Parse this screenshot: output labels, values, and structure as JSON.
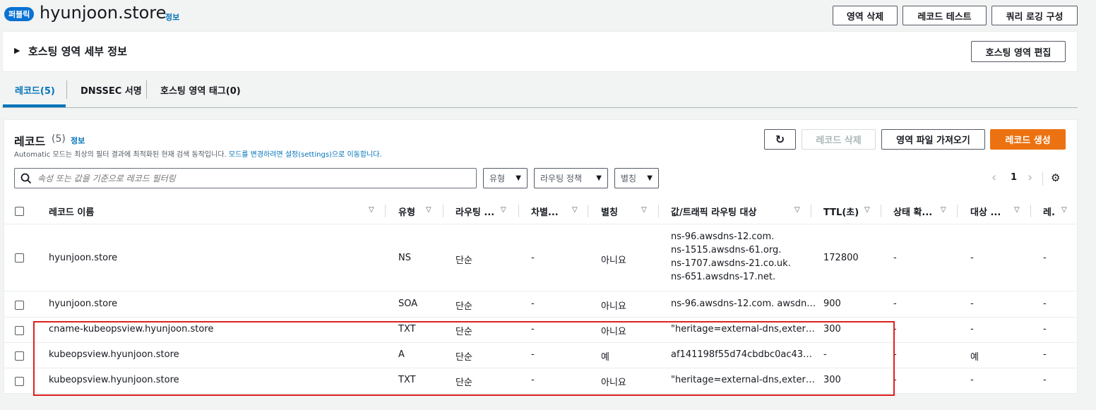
{
  "header": {
    "badge": "퍼블릭",
    "title": "hyunjoon.store",
    "info": "정보",
    "buttons": [
      "영역 삭제",
      "레코드 테스트",
      "쿼리 로깅 구성"
    ]
  },
  "details": {
    "label": "호스팅 영역 세부 정보",
    "edit_button": "호스팅 영역 편집"
  },
  "tabs": [
    "레코드(5)",
    "DNSSEC 서명",
    "호스팅 영역 태그(0)"
  ],
  "records": {
    "title": "레코드",
    "count": "(5)",
    "info": "정보",
    "desc_prefix": "Automatic 모드는 최상의 필터 결과에 최적화된 현재 검색 동작입니다.",
    "desc_link": "모드를 변경하려면 설정(settings)으로 이동합니다.",
    "buttons": {
      "delete": "레코드 삭제",
      "import": "영역 파일 가져오기",
      "create": "레코드 생성"
    },
    "search_placeholder": "속성 또는 값을 기준으로 레코드 필터링",
    "filters": [
      "유형",
      "라우팅 정책",
      "별칭"
    ],
    "page": "1",
    "columns": [
      "레코드 이름",
      "유형",
      "라우팅 ...",
      "차별...",
      "별칭",
      "값/트래픽 라우팅 대상",
      "TTL(초)",
      "상태 확...",
      "대상 ...",
      "레."
    ],
    "rows": [
      {
        "name": "hyunjoon.store",
        "type": "NS",
        "routing": "단순",
        "diff": "-",
        "alias": "아니요",
        "value": [
          "ns-96.awsdns-12.com.",
          "ns-1515.awsdns-61.org.",
          "ns-1707.awsdns-21.co.uk.",
          "ns-651.awsdns-17.net."
        ],
        "ttl": "172800",
        "health": "-",
        "target": "-",
        "rec": "-"
      },
      {
        "name": "hyunjoon.store",
        "type": "SOA",
        "routing": "단순",
        "diff": "-",
        "alias": "아니요",
        "value": [
          "ns-96.awsdns-12.com. awsdn…"
        ],
        "ttl": "900",
        "health": "-",
        "target": "-",
        "rec": "-"
      },
      {
        "name": "cname-kubeopsview.hyunjoon.store",
        "type": "TXT",
        "routing": "단순",
        "diff": "-",
        "alias": "아니요",
        "value": [
          "\"heritage=external-dns,exter…"
        ],
        "ttl": "300",
        "health": "-",
        "target": "-",
        "rec": "-"
      },
      {
        "name": "kubeopsview.hyunjoon.store",
        "type": "A",
        "routing": "단순",
        "diff": "-",
        "alias": "예",
        "value": [
          "af141198f55d74cbdbc0ac43…"
        ],
        "ttl": "-",
        "health": "-",
        "target": "예",
        "rec": "-"
      },
      {
        "name": "kubeopsview.hyunjoon.store",
        "type": "TXT",
        "routing": "단순",
        "diff": "-",
        "alias": "아니요",
        "value": [
          "\"heritage=external-dns,exter…"
        ],
        "ttl": "300",
        "health": "-",
        "target": "-",
        "rec": "-"
      }
    ]
  },
  "colors": {
    "accent": "#0073bb",
    "primary_button": "#ec7211",
    "highlight_box": "#e02020"
  }
}
